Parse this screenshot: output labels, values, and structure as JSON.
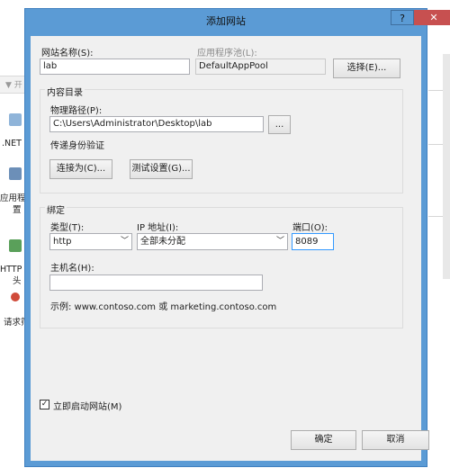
{
  "dialog": {
    "title": "添加网站",
    "help_label": "?",
    "close_label": "✕"
  },
  "form": {
    "site_name_label": "网站名称(S):",
    "site_name_value": "lab",
    "app_pool_label": "应用程序池(L):",
    "app_pool_value": "DefaultAppPool",
    "select_button": "选择(E)...",
    "content_dir_label": "内容目录",
    "physical_path_label": "物理路径(P):",
    "physical_path_value": "C:\\Users\\Administrator\\Desktop\\lab",
    "browse_button": "...",
    "auth_label": "传递身份验证",
    "connect_as_button": "连接为(C)...",
    "test_settings_button": "测试设置(G)...",
    "binding_label": "绑定",
    "type_label": "类型(T):",
    "type_value": "http",
    "ip_label": "IP 地址(I):",
    "ip_value": "全部未分配",
    "port_label": "端口(O):",
    "port_value": "8089",
    "hostname_label": "主机名(H):",
    "hostname_value": "",
    "example_text": "示例: www.contoso.com 或 marketing.contoso.com",
    "start_site_label": "立即启动网站(M)",
    "start_site_checked": true,
    "ok_button": "确定",
    "cancel_button": "取消"
  },
  "background": {
    "toolbar_text": "开",
    "items": [
      ".NET",
      "应用程",
      "置",
      "HTTP 响",
      "头",
      "请求筛"
    ]
  },
  "colors": {
    "title_bar": "#5b9bd5",
    "close_button": "#c75050",
    "dialog_body": "#f0f0f0"
  }
}
